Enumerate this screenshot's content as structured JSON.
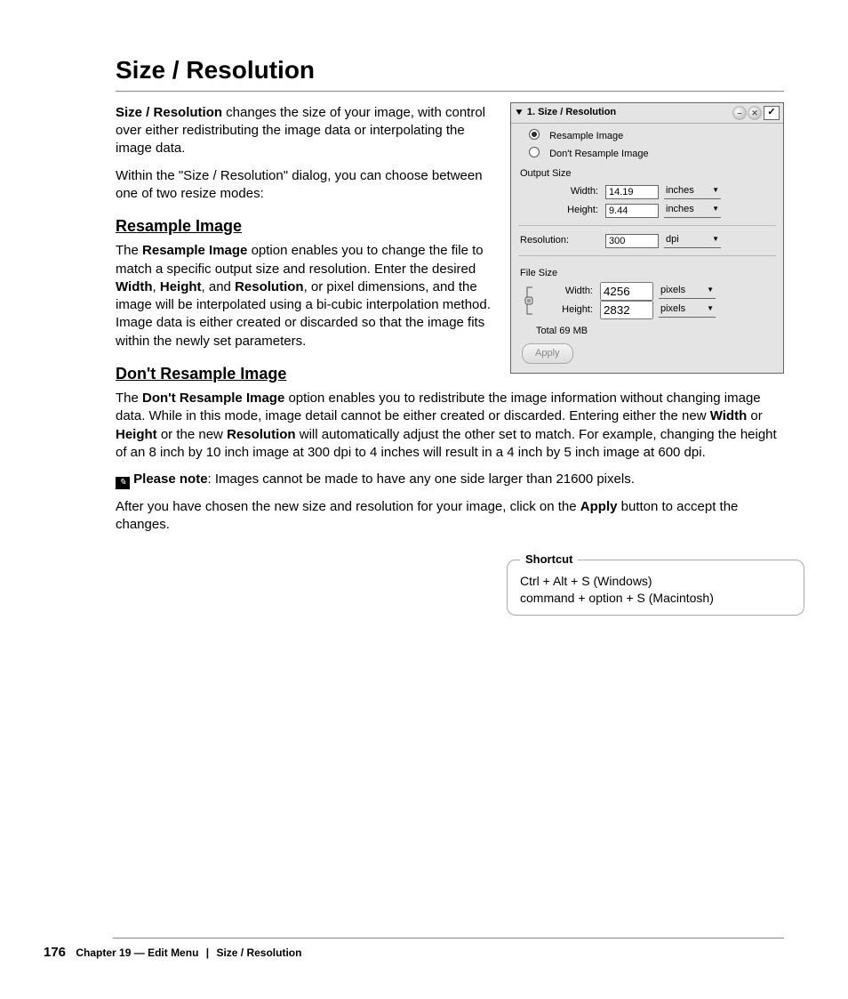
{
  "title": "Size / Resolution",
  "intro": {
    "p1_lead": "Size / Resolution",
    "p1_rest": " changes the size of your image, with control over either redistributing the image data or interpolating the image data.",
    "p2": "Within the \"Size / Resolution\" dialog, you can choose between one of two resize modes:"
  },
  "resample": {
    "heading": "Resample Image",
    "pre": "The ",
    "b1": "Resample Image",
    "mid1": " option enables you to change the file to match a specific output size and resolution. Enter the desired ",
    "bW": "Width",
    "c1": ", ",
    "bH": "Height",
    "c2": ", and ",
    "bR": "Resolution",
    "rest": ", or pixel dimensions, and the image will be interpolated using a bi-cubic interpolation method. Image data is either created or discarded so that the image fits within the newly set parameters."
  },
  "dont": {
    "heading": "Don't Resample Image",
    "pre": "The ",
    "b1": "Don't Resample Image",
    "mid1": " option enables you to redistribute the image information without changing image data. While in this mode, image detail cannot be either created or discarded. Entering either the new ",
    "bW": "Width",
    "or1": " or ",
    "bH": "Height",
    "mid2": " or the new ",
    "bR": "Resolution",
    "rest": " will automatically adjust the other set to match. For example, changing the height of an 8 inch by 10 inch image at 300 dpi to 4 inches will result in a 4 inch by 5 inch image at 600 dpi."
  },
  "note": {
    "label": "Please note",
    "text": ": Images cannot be made to have any one side larger than 21600 pixels."
  },
  "apply_para": {
    "pre": "After you have chosen the new size and resolution for your image, click on the ",
    "b": "Apply",
    "post": " button to accept the changes."
  },
  "shortcut": {
    "legend": "Shortcut",
    "win": "Ctrl + Alt + S (Windows)",
    "mac": "command + option + S (Macintosh)"
  },
  "footer": {
    "page": "176",
    "chapter_label": "Chapter 19 — Edit Menu",
    "section": "Size / Resolution"
  },
  "dialog": {
    "title": "1. Size / Resolution",
    "radio_resample": "Resample Image",
    "radio_dont": "Don't Resample Image",
    "output_label": "Output Size",
    "width_label": "Width:",
    "height_label": "Height:",
    "width_val": "14.19",
    "height_val": "9.44",
    "unit_inches": "inches",
    "res_label": "Resolution:",
    "res_val": "300",
    "unit_dpi": "dpi",
    "file_label": "File Size",
    "fs_width_val": "4256",
    "fs_height_val": "2832",
    "unit_pixels": "pixels",
    "total": "Total 69 MB",
    "apply": "Apply",
    "ok_mark": "✓",
    "x_mark": "✕",
    "min_mark": "–"
  }
}
